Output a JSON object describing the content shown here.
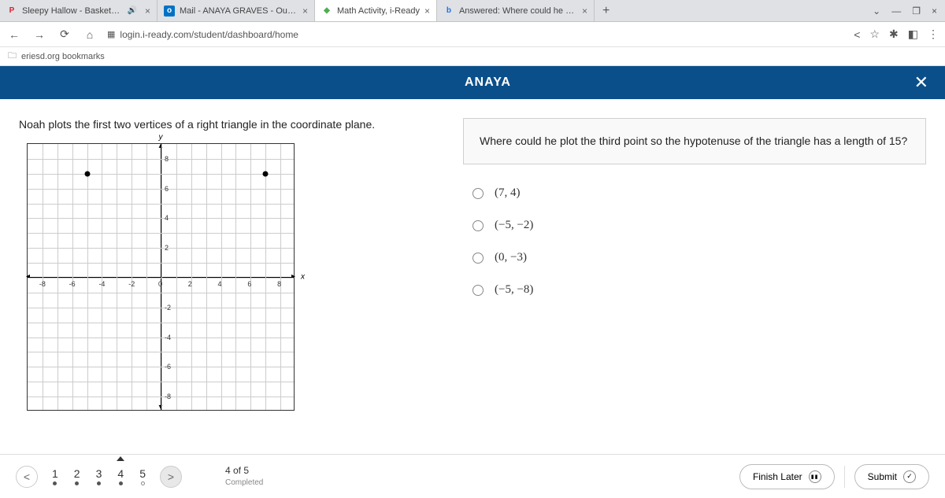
{
  "tabs": [
    {
      "favicon": "P",
      "faviconColor": "#d23",
      "title": "Sleepy Hallow - Basketball D",
      "hasSpeaker": true
    },
    {
      "favicon": "O",
      "faviconColor": "#0072c6",
      "title": "Mail - ANAYA GRAVES - Outlook"
    },
    {
      "favicon": "◆",
      "faviconColor": "#4caf50",
      "title": "Math Activity, i-Ready",
      "active": true
    },
    {
      "favicon": "b",
      "faviconColor": "#1a73e8",
      "title": "Answered: Where could he plot t"
    }
  ],
  "address": {
    "url": "login.i-ready.com/student/dashboard/home"
  },
  "bookmarks": {
    "item": "eriesd.org bookmarks"
  },
  "header": {
    "student": "ANAYA"
  },
  "prompt": "Noah plots the first two vertices of a right triangle in the coordinate plane.",
  "chart_data": {
    "type": "scatter",
    "xlabel": "x",
    "ylabel": "y",
    "x_ticks": [
      -8,
      -6,
      -4,
      -2,
      0,
      2,
      4,
      6,
      8
    ],
    "y_ticks": [
      -8,
      -6,
      -4,
      -2,
      0,
      2,
      4,
      6,
      8
    ],
    "xlim": [
      -9,
      9
    ],
    "ylim": [
      -9,
      9
    ],
    "points": [
      {
        "x": -5,
        "y": 7
      },
      {
        "x": 7,
        "y": 7
      }
    ]
  },
  "question": "Where could he plot the third point so the hypotenuse of the triangle has a length of 15?",
  "options": [
    "(7, 4)",
    "(−5, −2)",
    "(0, −3)",
    "(−5, −8)"
  ],
  "nav": {
    "questions": [
      "1",
      "2",
      "3",
      "4",
      "5"
    ],
    "current": 4,
    "progress_main": "4 of 5",
    "progress_sub": "Completed"
  },
  "buttons": {
    "finish": "Finish Later",
    "submit": "Submit"
  }
}
